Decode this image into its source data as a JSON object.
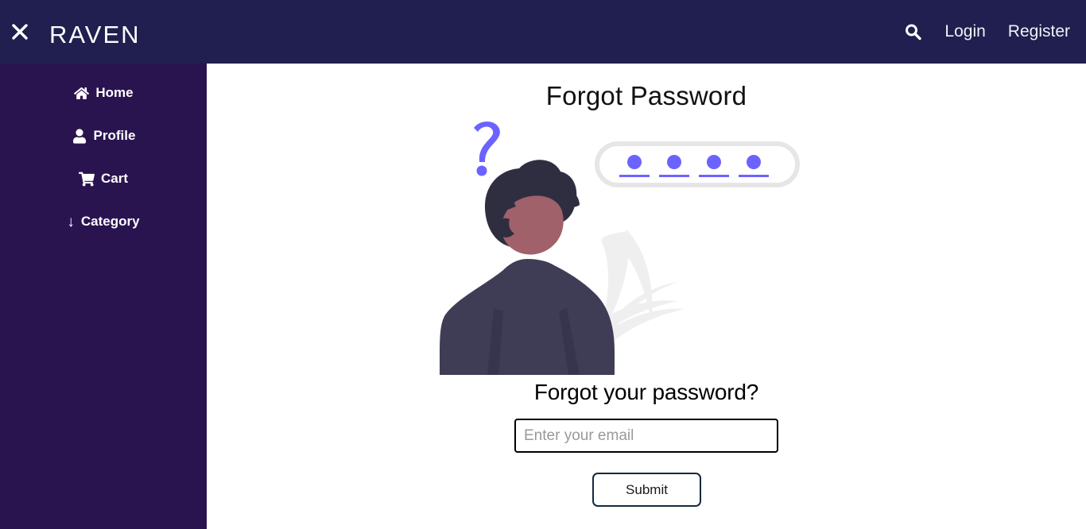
{
  "header": {
    "menu_toggle_icon": "close-x-icon",
    "brand": "Raven",
    "search_icon": "search-icon",
    "login_label": "Login",
    "register_label": "Register",
    "background_color": "#201f4f"
  },
  "sidebar": {
    "background_color": "#2a1450",
    "items": [
      {
        "label": "Home",
        "icon": "home-icon"
      },
      {
        "label": "Profile",
        "icon": "user-icon"
      },
      {
        "label": "Cart",
        "icon": "shopping-cart-icon"
      },
      {
        "label": "Category",
        "icon": "arrow-down-icon",
        "glyph": "↓"
      }
    ]
  },
  "main": {
    "page_title": "Forgot Password",
    "subtitle": "Forgot your password?",
    "email": {
      "value": "",
      "placeholder": "Enter your email"
    },
    "submit_label": "Submit",
    "illustration": {
      "name": "forgot-password-illustration",
      "question_mark_color": "#6c63ff",
      "dot_color": "#6c63ff",
      "password_dots": 4,
      "field_border_color": "#e6e6e6",
      "hair_color": "#2f2e41",
      "skin_color": "#a0616a",
      "suit_color": "#3f3d56",
      "leaf_color": "#efefef"
    }
  }
}
